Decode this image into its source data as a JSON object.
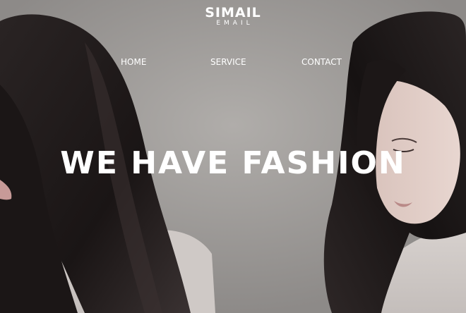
{
  "logo": {
    "title": "SIMAIL",
    "subtitle": "EMAIL"
  },
  "nav": {
    "items": [
      {
        "label": "HOME"
      },
      {
        "label": "SERVICE"
      },
      {
        "label": "CONTACT"
      }
    ]
  },
  "hero": {
    "headline": "WE HAVE FASHION",
    "image": "two-women-long-dark-hair-photo"
  },
  "colors": {
    "text": "#ffffff",
    "background": "#a29e9b",
    "hair": "#1c1717",
    "skin": "#e2cdc6"
  }
}
